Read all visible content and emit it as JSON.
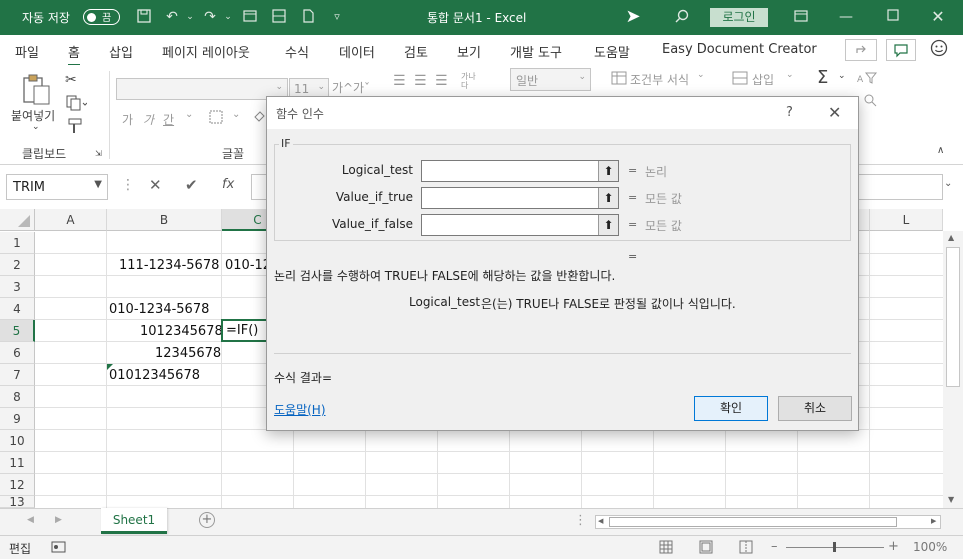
{
  "titlebar": {
    "autosave_label": "자동 저장",
    "autosave_state": "끔",
    "title": "통합 문서1  -  Excel",
    "login_label": "로그인"
  },
  "menu": {
    "tabs": [
      "파일",
      "홈",
      "삽입",
      "페이지 레이아웃",
      "수식",
      "데이터",
      "검토",
      "보기",
      "개발 도구",
      "도움말",
      "Easy Document Creator"
    ],
    "selected_tab": "홈"
  },
  "ribbon": {
    "paste_label": "붙여넣기",
    "clipboard_group": "클립보드",
    "font_group": "글꼴",
    "font_size": "11",
    "font_grow": "가^",
    "font_shrink": "가ˇ",
    "bold_korean": "가",
    "italic_korean": "가",
    "underline_korean": "간",
    "wrap_text_label": "가나\n다",
    "number_format": "일반",
    "conditional_format": "조건부 서식",
    "insert_label": "삽입"
  },
  "formula_bar": {
    "name_box": "TRIM",
    "fx_label": "fx"
  },
  "grid": {
    "columns": [
      "A",
      "B",
      "C",
      "L"
    ],
    "rows": [
      "1",
      "2",
      "3",
      "4",
      "5",
      "6",
      "7",
      "8",
      "9",
      "10",
      "11",
      "12",
      "13"
    ],
    "cells": {
      "B2": "111-1234-5678",
      "C2": "010-12",
      "B4": "010-1234-5678",
      "B5": "1012345678",
      "C5": "=IF()",
      "B6": "12345678",
      "B7": "01012345678"
    }
  },
  "dialog": {
    "title": "함수 인수",
    "help_q": "?",
    "function_name": "IF",
    "args": [
      {
        "name": "Logical_test",
        "hint": "논리"
      },
      {
        "name": "Value_if_true",
        "hint": "모든 값"
      },
      {
        "name": "Value_if_false",
        "hint": "모든 값"
      }
    ],
    "equals": "=",
    "description": "논리 검사를 수행하여 TRUE나 FALSE에 해당하는 값을 반환합니다.",
    "arg_description_name": "Logical_test",
    "arg_description": "은(는) TRUE나 FALSE로 판정될 값이나 식입니다.",
    "formula_result": "수식 결과=",
    "help_link": "도움말(H)",
    "ok_label": "확인",
    "cancel_label": "취소"
  },
  "sheets": {
    "active": "Sheet1"
  },
  "status": {
    "mode": "편집",
    "zoom": "100%"
  },
  "colors": {
    "brand": "#217346",
    "selection_border": "#217346",
    "link": "#0563c1"
  }
}
